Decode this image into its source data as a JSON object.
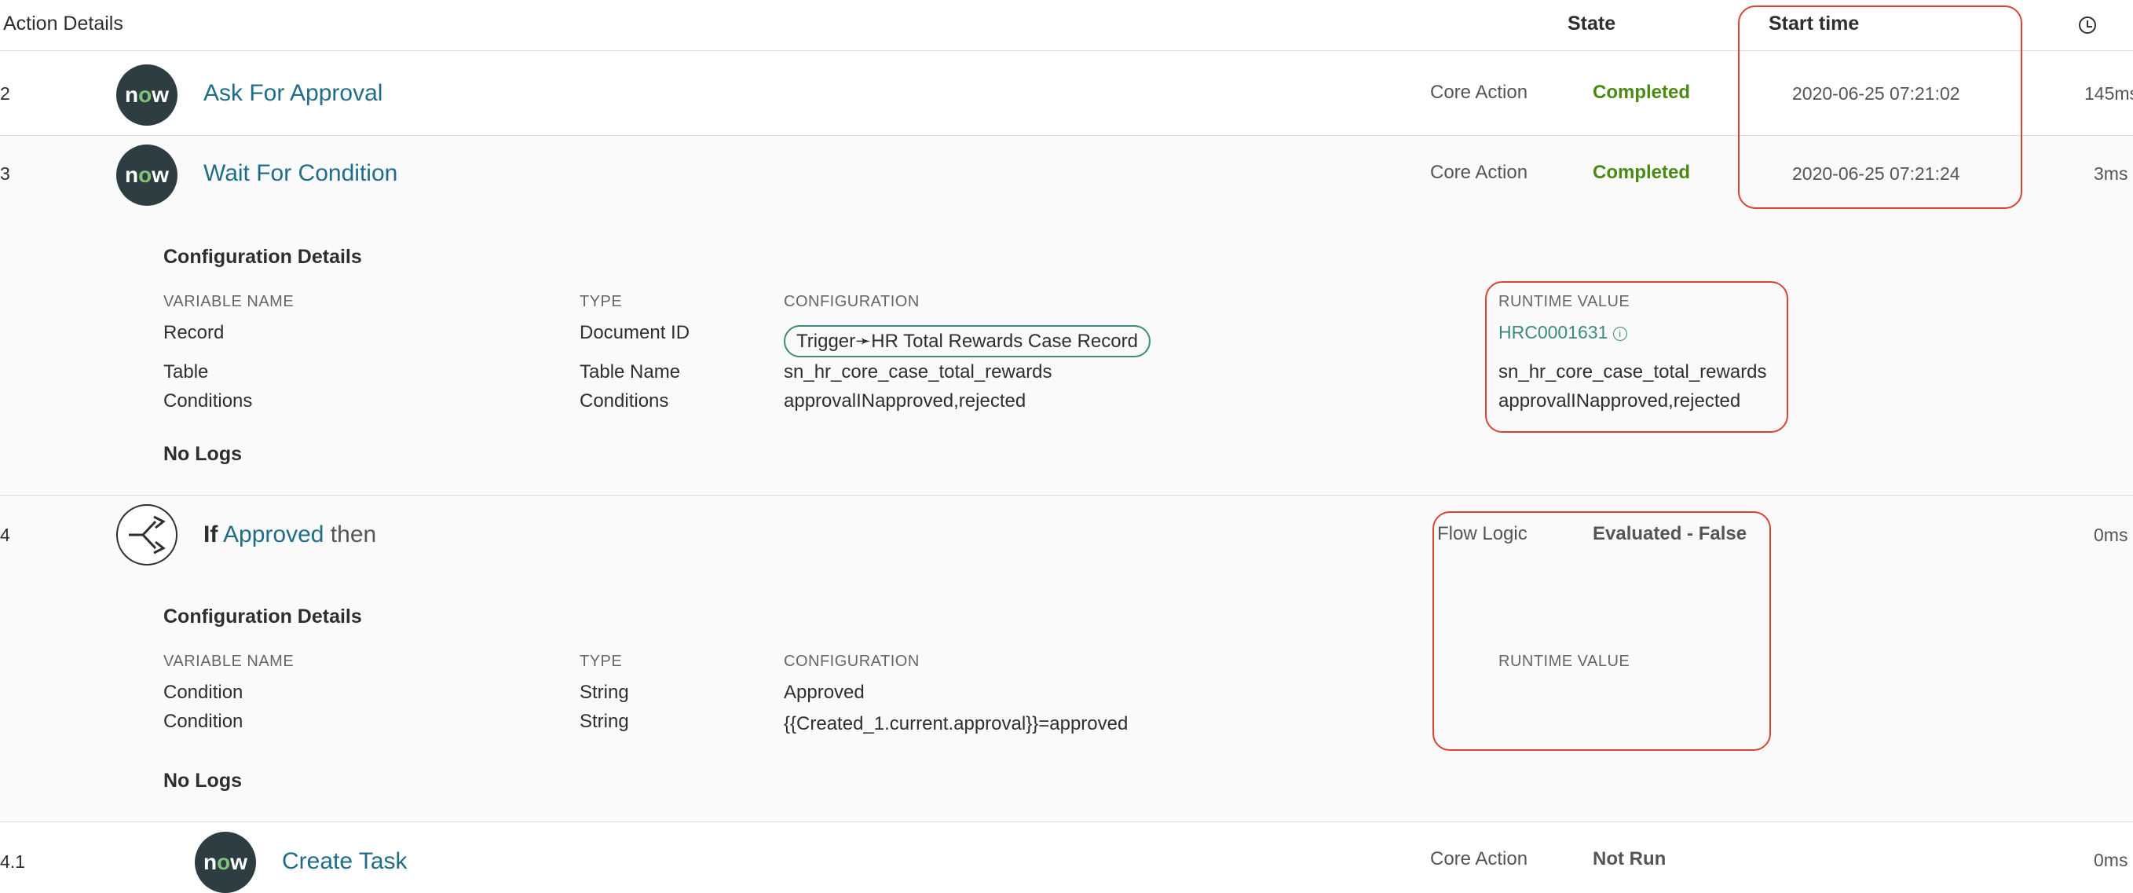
{
  "header": {
    "action_details": "Action Details",
    "state": "State",
    "start_time": "Start time",
    "duration_icon": "clock-icon"
  },
  "rows": [
    {
      "num": "2",
      "title": "Ask For Approval",
      "type": "Core Action",
      "state": "Completed",
      "start_time": "2020-06-25 07:21:02",
      "duration": "145ms"
    },
    {
      "num": "3",
      "title": "Wait For Condition",
      "type": "Core Action",
      "state": "Completed",
      "start_time": "2020-06-25 07:21:24",
      "duration": "3ms",
      "config": {
        "title": "Configuration Details",
        "headers": {
          "variable_name": "VARIABLE NAME",
          "type": "TYPE",
          "configuration": "CONFIGURATION",
          "runtime_value": "RUNTIME VALUE"
        },
        "vars": [
          {
            "name": "Record",
            "type": "Document ID",
            "config": "Trigger➛HR Total Rewards Case Record",
            "runtime": "HRC0001631"
          },
          {
            "name": "Table",
            "type": "Table Name",
            "config": "sn_hr_core_case_total_rewards",
            "runtime": "sn_hr_core_case_total_rewards"
          },
          {
            "name": "Conditions",
            "type": "Conditions",
            "config": "approvalINapproved,rejected",
            "runtime": "approvalINapproved,rejected"
          }
        ],
        "logs": "No Logs"
      }
    },
    {
      "num": "4",
      "title_prefix": "If",
      "title_link": "Approved",
      "title_suffix": "then",
      "type": "Flow Logic",
      "state": "Evaluated - False",
      "duration": "0ms",
      "config": {
        "title": "Configuration Details",
        "headers": {
          "variable_name": "VARIABLE NAME",
          "type": "TYPE",
          "configuration": "CONFIGURATION",
          "runtime_value": "RUNTIME VALUE"
        },
        "vars": [
          {
            "name": "Condition",
            "type": "String",
            "config": "Approved"
          },
          {
            "name": "Condition",
            "type": "String",
            "config": "{{Created_1.current.approval}}=approved"
          }
        ],
        "logs": "No Logs"
      }
    },
    {
      "num": "4.1",
      "title": "Create Task",
      "type": "Core Action",
      "state": "Not Run",
      "duration": "0ms"
    }
  ],
  "logo": {
    "text_n": "n",
    "text_o": "o",
    "text_w": "w"
  },
  "colors": {
    "accent_link": "#1f6d86",
    "completed": "#4a8a12",
    "highlight_box": "#d9432f",
    "pill_border": "#3b8a7c"
  }
}
